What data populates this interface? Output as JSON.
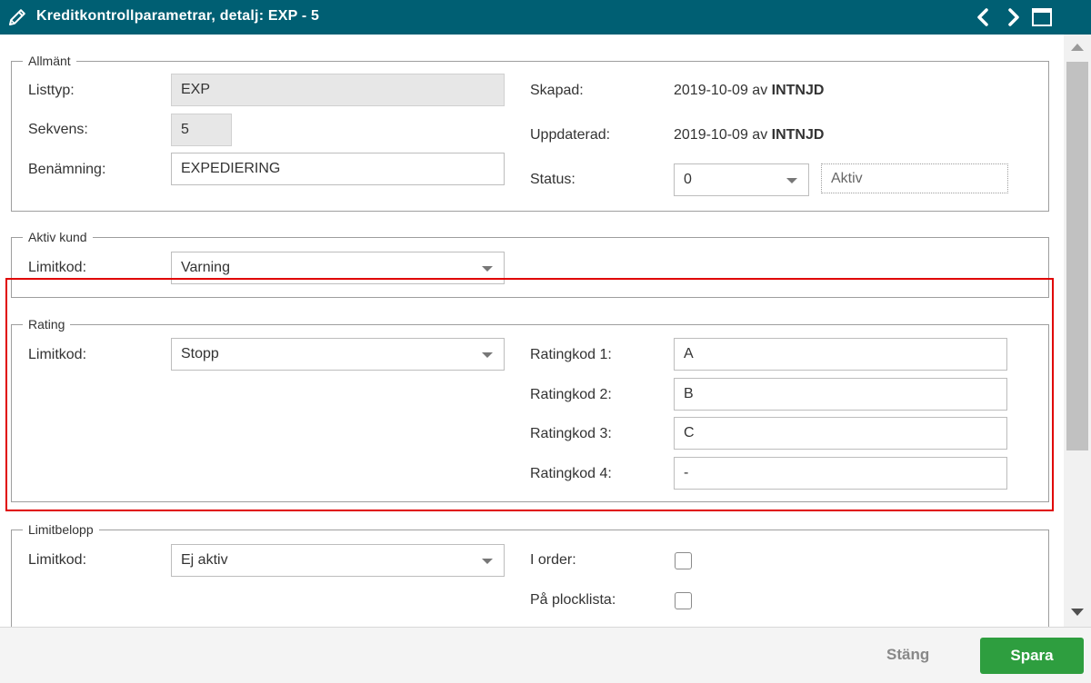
{
  "window": {
    "title": "Kreditkontrollparametrar, detalj: EXP - 5",
    "icons": [
      "pencil-icon",
      "chevron-left-icon",
      "chevron-right-icon",
      "maximize-icon"
    ]
  },
  "allmant": {
    "legend": "Allmänt",
    "listtyp_label": "Listtyp:",
    "listtyp_value": "EXP",
    "sekvens_label": "Sekvens:",
    "sekvens_value": "5",
    "benamning_label": "Benämning:",
    "benamning_value": "EXPEDIERING",
    "skapad_label": "Skapad:",
    "skapad_date": "2019-10-09 av",
    "skapad_user": "INTNJD",
    "uppdaterad_label": "Uppdaterad:",
    "uppdaterad_date": "2019-10-09 av",
    "uppdaterad_user": "INTNJD",
    "status_label": "Status:",
    "status_value": "0",
    "status_text": "Aktiv"
  },
  "aktiv_kund": {
    "legend": "Aktiv kund",
    "limitkod_label": "Limitkod:",
    "limitkod_value": "Varning"
  },
  "rating": {
    "legend": "Rating",
    "limitkod_label": "Limitkod:",
    "limitkod_value": "Stopp",
    "codes": [
      {
        "label": "Ratingkod 1:",
        "value": "A"
      },
      {
        "label": "Ratingkod 2:",
        "value": "B"
      },
      {
        "label": "Ratingkod 3:",
        "value": "C"
      },
      {
        "label": "Ratingkod 4:",
        "value": "-"
      }
    ]
  },
  "limitbelopp": {
    "legend": "Limitbelopp",
    "limitkod_label": "Limitkod:",
    "limitkod_value": "Ej aktiv",
    "i_order_label": "I order:",
    "i_order_checked": false,
    "plocklista_label": "På plocklista:",
    "plocklista_checked": false
  },
  "footer": {
    "close_label": "Stäng",
    "save_label": "Spara"
  },
  "colors": {
    "titlebar": "#005f73",
    "save_button": "#2e9e3f",
    "highlight": "#e00000"
  }
}
